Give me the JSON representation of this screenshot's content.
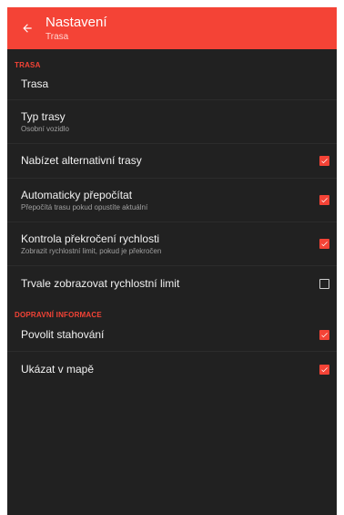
{
  "header": {
    "title": "Nastavení",
    "subtitle": "Trasa",
    "color": "#f44336"
  },
  "sections": {
    "route": "TRASA",
    "traffic": "DOPRAVNÍ INFORMACE"
  },
  "items": {
    "trasa": {
      "label": "Trasa"
    },
    "typ_trasy": {
      "label": "Typ trasy",
      "sub": "Osobní vozidlo"
    },
    "alternativni": {
      "label": "Nabízet alternativní trasy",
      "checked": true
    },
    "prepocitat": {
      "label": "Automaticky přepočítat",
      "sub": "Přepočítá trasu pokud opustíte aktuální",
      "checked": true
    },
    "rychlost": {
      "label": "Kontrola překročení rychlosti",
      "sub": "Zobrazit rychlostní limit, pokud je překročen",
      "checked": true
    },
    "trvale": {
      "label": "Trvale zobrazovat rychlostní limit",
      "checked": false
    },
    "stahovani": {
      "label": "Povolit stahování",
      "checked": true
    },
    "mapa": {
      "label": "Ukázat v mapě",
      "checked": true
    }
  },
  "icons": {
    "back": "arrow-left-icon",
    "checkbox_on": "checkbox-checked-icon",
    "checkbox_off": "checkbox-unchecked-icon"
  }
}
